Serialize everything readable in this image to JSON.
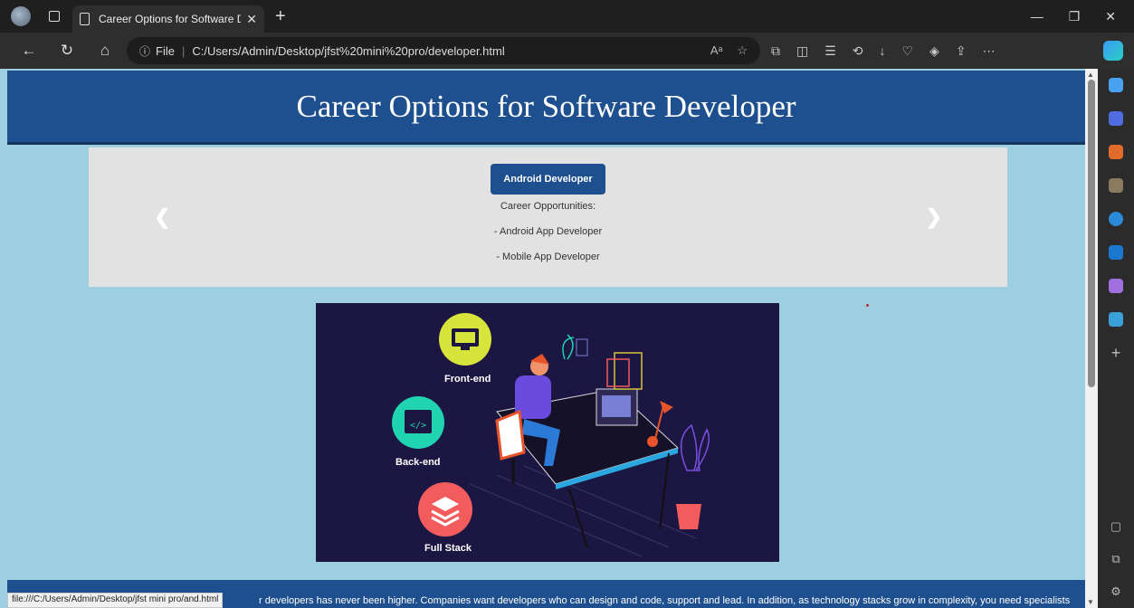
{
  "browser": {
    "tab_title": "Career Options for Software Dev",
    "url_scheme": "File",
    "url": "C:/Users/Admin/Desktop/jfst%20mini%20pro/developer.html",
    "status_url": "file:///C:/Users/Admin/Desktop/jfst mini pro/and.html"
  },
  "page": {
    "title": "Career Options for Software Developer",
    "carousel": {
      "active_button": "Android Developer",
      "subtitle": "Career Opportunities:",
      "items": [
        "- Android App Developer",
        "- Mobile App Developer"
      ]
    },
    "hero": {
      "labels": [
        "Front-end",
        "Back-end",
        "Full Stack"
      ]
    },
    "footer_text": "r developers has never been higher. Companies want developers who can design and code, support and lead. In addition, as technology stacks grow in complexity, you need specialists"
  },
  "colors": {
    "header_bg": "#1e4f8e",
    "page_bg": "#9ecfe0",
    "carousel_bg": "#e2e2e2",
    "hero_bg": "#1c1742"
  }
}
